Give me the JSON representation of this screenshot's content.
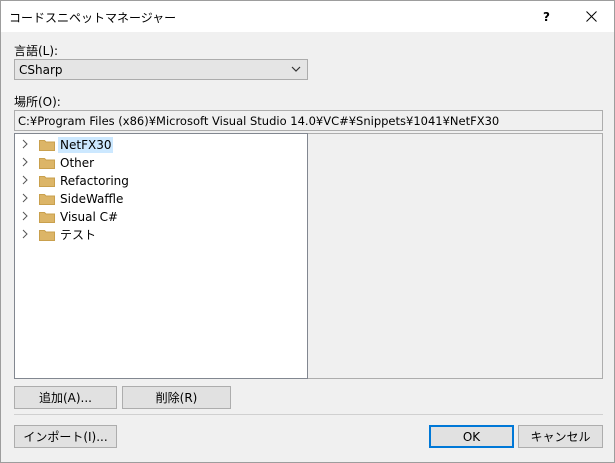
{
  "window": {
    "title": "コードスニペットマネージャー",
    "help_label": "?",
    "close_label": "✕"
  },
  "language": {
    "label": "言語(L):",
    "selected": "CSharp"
  },
  "location": {
    "label": "場所(O):",
    "path": "C:¥Program Files (x86)¥Microsoft Visual Studio 14.0¥VC#¥Snippets¥1041¥NetFX30"
  },
  "tree": {
    "items": [
      {
        "label": "NetFX30",
        "selected": true
      },
      {
        "label": "Other",
        "selected": false
      },
      {
        "label": "Refactoring",
        "selected": false
      },
      {
        "label": "SideWaffle",
        "selected": false
      },
      {
        "label": "Visual C#",
        "selected": false
      },
      {
        "label": "テスト",
        "selected": false
      }
    ]
  },
  "buttons": {
    "add": "追加(A)...",
    "remove": "削除(R)",
    "import": "インポート(I)...",
    "ok": "OK",
    "cancel": "キャンセル"
  },
  "colors": {
    "folder": "#dcb567",
    "selection": "#cce8ff",
    "accent": "#0078d7"
  },
  "icons": {
    "chevron": "chevron-right-icon",
    "folder": "folder-icon",
    "dropdown": "chevron-down-icon"
  }
}
